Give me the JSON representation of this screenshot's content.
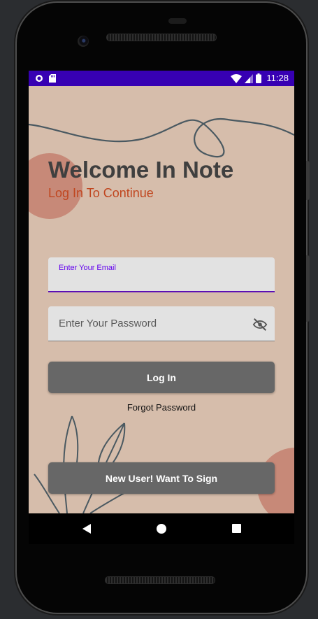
{
  "status_bar": {
    "time": "11:28"
  },
  "welcome": {
    "title": "Welcome In Note",
    "subtitle": "Log In To Continue"
  },
  "login_form": {
    "email_label": "Enter Your Email",
    "email_value": "",
    "password_placeholder": "Enter Your Password",
    "login_button": "Log In",
    "forgot_password": "Forgot Password",
    "signup_button": "New User! Want To Sign"
  },
  "icons": {
    "status_left": [
      "circle-notification-icon",
      "sd-card-icon"
    ],
    "status_right": [
      "wifi-icon",
      "cellular-signal-icon",
      "battery-icon"
    ],
    "password_toggle": "visibility-off-icon",
    "nav": [
      "back-icon",
      "home-icon",
      "recents-icon"
    ]
  },
  "colors": {
    "status_bar": "#3700b3",
    "background": "#d6bdab",
    "title": "#3f3f3f",
    "subtitle": "#c0461f",
    "accent": "#6200ee",
    "button": "#676767"
  }
}
